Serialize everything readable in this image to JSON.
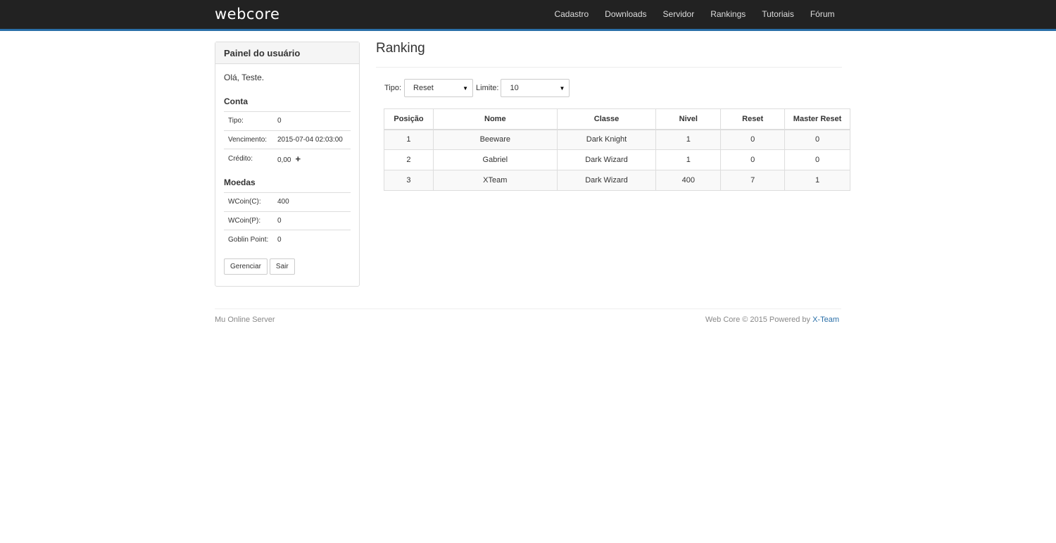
{
  "navbar": {
    "brand": "webcore",
    "items": [
      "Cadastro",
      "Downloads",
      "Servidor",
      "Rankings",
      "Tutoriais",
      "Fórum"
    ]
  },
  "sidebar": {
    "title": "Painel do usuário",
    "greeting": "Olá, Teste.",
    "account": {
      "title": "Conta",
      "rows": [
        {
          "label": "Tipo:",
          "value": "0"
        },
        {
          "label": "Vencimento:",
          "value": "2015-07-04 02:03:00"
        },
        {
          "label": "Crédito:",
          "value": "0,00"
        }
      ],
      "add_symbol": "+"
    },
    "coins": {
      "title": "Moedas",
      "rows": [
        {
          "label": "WCoin(C):",
          "value": "400"
        },
        {
          "label": "WCoin(P):",
          "value": "0"
        },
        {
          "label": "Goblin Point:",
          "value": "0"
        }
      ]
    },
    "buttons": {
      "manage": "Gerenciar",
      "logout": "Sair"
    }
  },
  "main": {
    "title": "Ranking",
    "filters": {
      "type_label": "Tipo:",
      "type_value": "Reset",
      "limit_label": "Limite:",
      "limit_value": "10"
    },
    "table": {
      "headers": [
        "Posição",
        "Nome",
        "Classe",
        "Nivel",
        "Reset",
        "Master Reset"
      ],
      "rows": [
        [
          "1",
          "Beeware",
          "Dark Knight",
          "1",
          "0",
          "0"
        ],
        [
          "2",
          "Gabriel",
          "Dark Wizard",
          "1",
          "0",
          "0"
        ],
        [
          "3",
          "XTeam",
          "Dark Wizard",
          "400",
          "7",
          "1"
        ]
      ]
    }
  },
  "footer": {
    "left": "Mu Online Server",
    "right_text": "Web Core © 2015 Powered by",
    "right_link": "X-Team"
  },
  "colors": {
    "navbar": "#222222",
    "accent": "#2a6fa8"
  }
}
